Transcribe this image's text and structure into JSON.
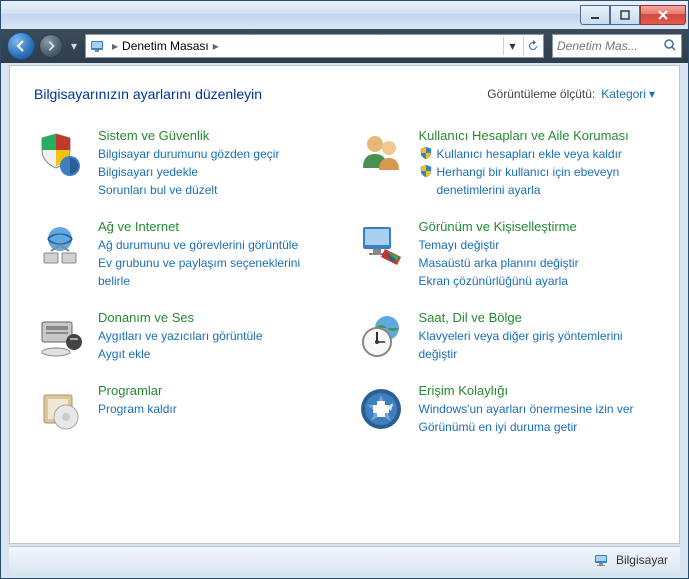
{
  "window": {
    "breadcrumb": "Denetim Masası",
    "search_placeholder": "Denetim Mas..."
  },
  "header": {
    "title": "Bilgisayarınızın ayarlarını düzenleyin",
    "view_label": "Görüntüleme ölçütü:",
    "view_value": "Kategori"
  },
  "left": [
    {
      "title": "Sistem ve Güvenlik",
      "links": [
        {
          "text": "Bilgisayar durumunu gözden geçir",
          "shield": false
        },
        {
          "text": "Bilgisayarı yedekle",
          "shield": false
        },
        {
          "text": "Sorunları bul ve düzelt",
          "shield": false
        }
      ]
    },
    {
      "title": "Ağ ve Internet",
      "links": [
        {
          "text": "Ağ durumunu ve görevlerini görüntüle",
          "shield": false
        },
        {
          "text": "Ev grubunu ve paylaşım seçeneklerini belirle",
          "shield": false
        }
      ]
    },
    {
      "title": "Donanım ve Ses",
      "links": [
        {
          "text": "Aygıtları ve yazıcıları görüntüle",
          "shield": false
        },
        {
          "text": "Aygıt ekle",
          "shield": false
        }
      ]
    },
    {
      "title": "Programlar",
      "links": [
        {
          "text": "Program kaldır",
          "shield": false
        }
      ]
    }
  ],
  "right": [
    {
      "title": "Kullanıcı Hesapları ve Aile Koruması",
      "links": [
        {
          "text": "Kullanıcı hesapları ekle veya kaldır",
          "shield": true
        },
        {
          "text": "Herhangi bir kullanıcı için ebeveyn denetimlerini ayarla",
          "shield": true
        }
      ]
    },
    {
      "title": "Görünüm ve Kişiselleştirme",
      "links": [
        {
          "text": "Temayı değiştir",
          "shield": false
        },
        {
          "text": "Masaüstü arka planını değiştir",
          "shield": false
        },
        {
          "text": "Ekran çözünürlüğünü ayarla",
          "shield": false
        }
      ]
    },
    {
      "title": "Saat, Dil ve Bölge",
      "links": [
        {
          "text": "Klavyeleri veya diğer giriş yöntemlerini değiştir",
          "shield": false
        }
      ]
    },
    {
      "title": "Erişim Kolaylığı",
      "links": [
        {
          "text": "Windows'un ayarları önermesine izin ver",
          "shield": false
        },
        {
          "text": "Görünümü en iyi duruma getir",
          "shield": false
        }
      ]
    }
  ],
  "status": {
    "text": "Bilgisayar"
  },
  "icons": {
    "system": "#",
    "network": "#",
    "hardware": "#",
    "programs": "#",
    "users": "#",
    "appearance": "#",
    "clock": "#",
    "access": "#"
  }
}
